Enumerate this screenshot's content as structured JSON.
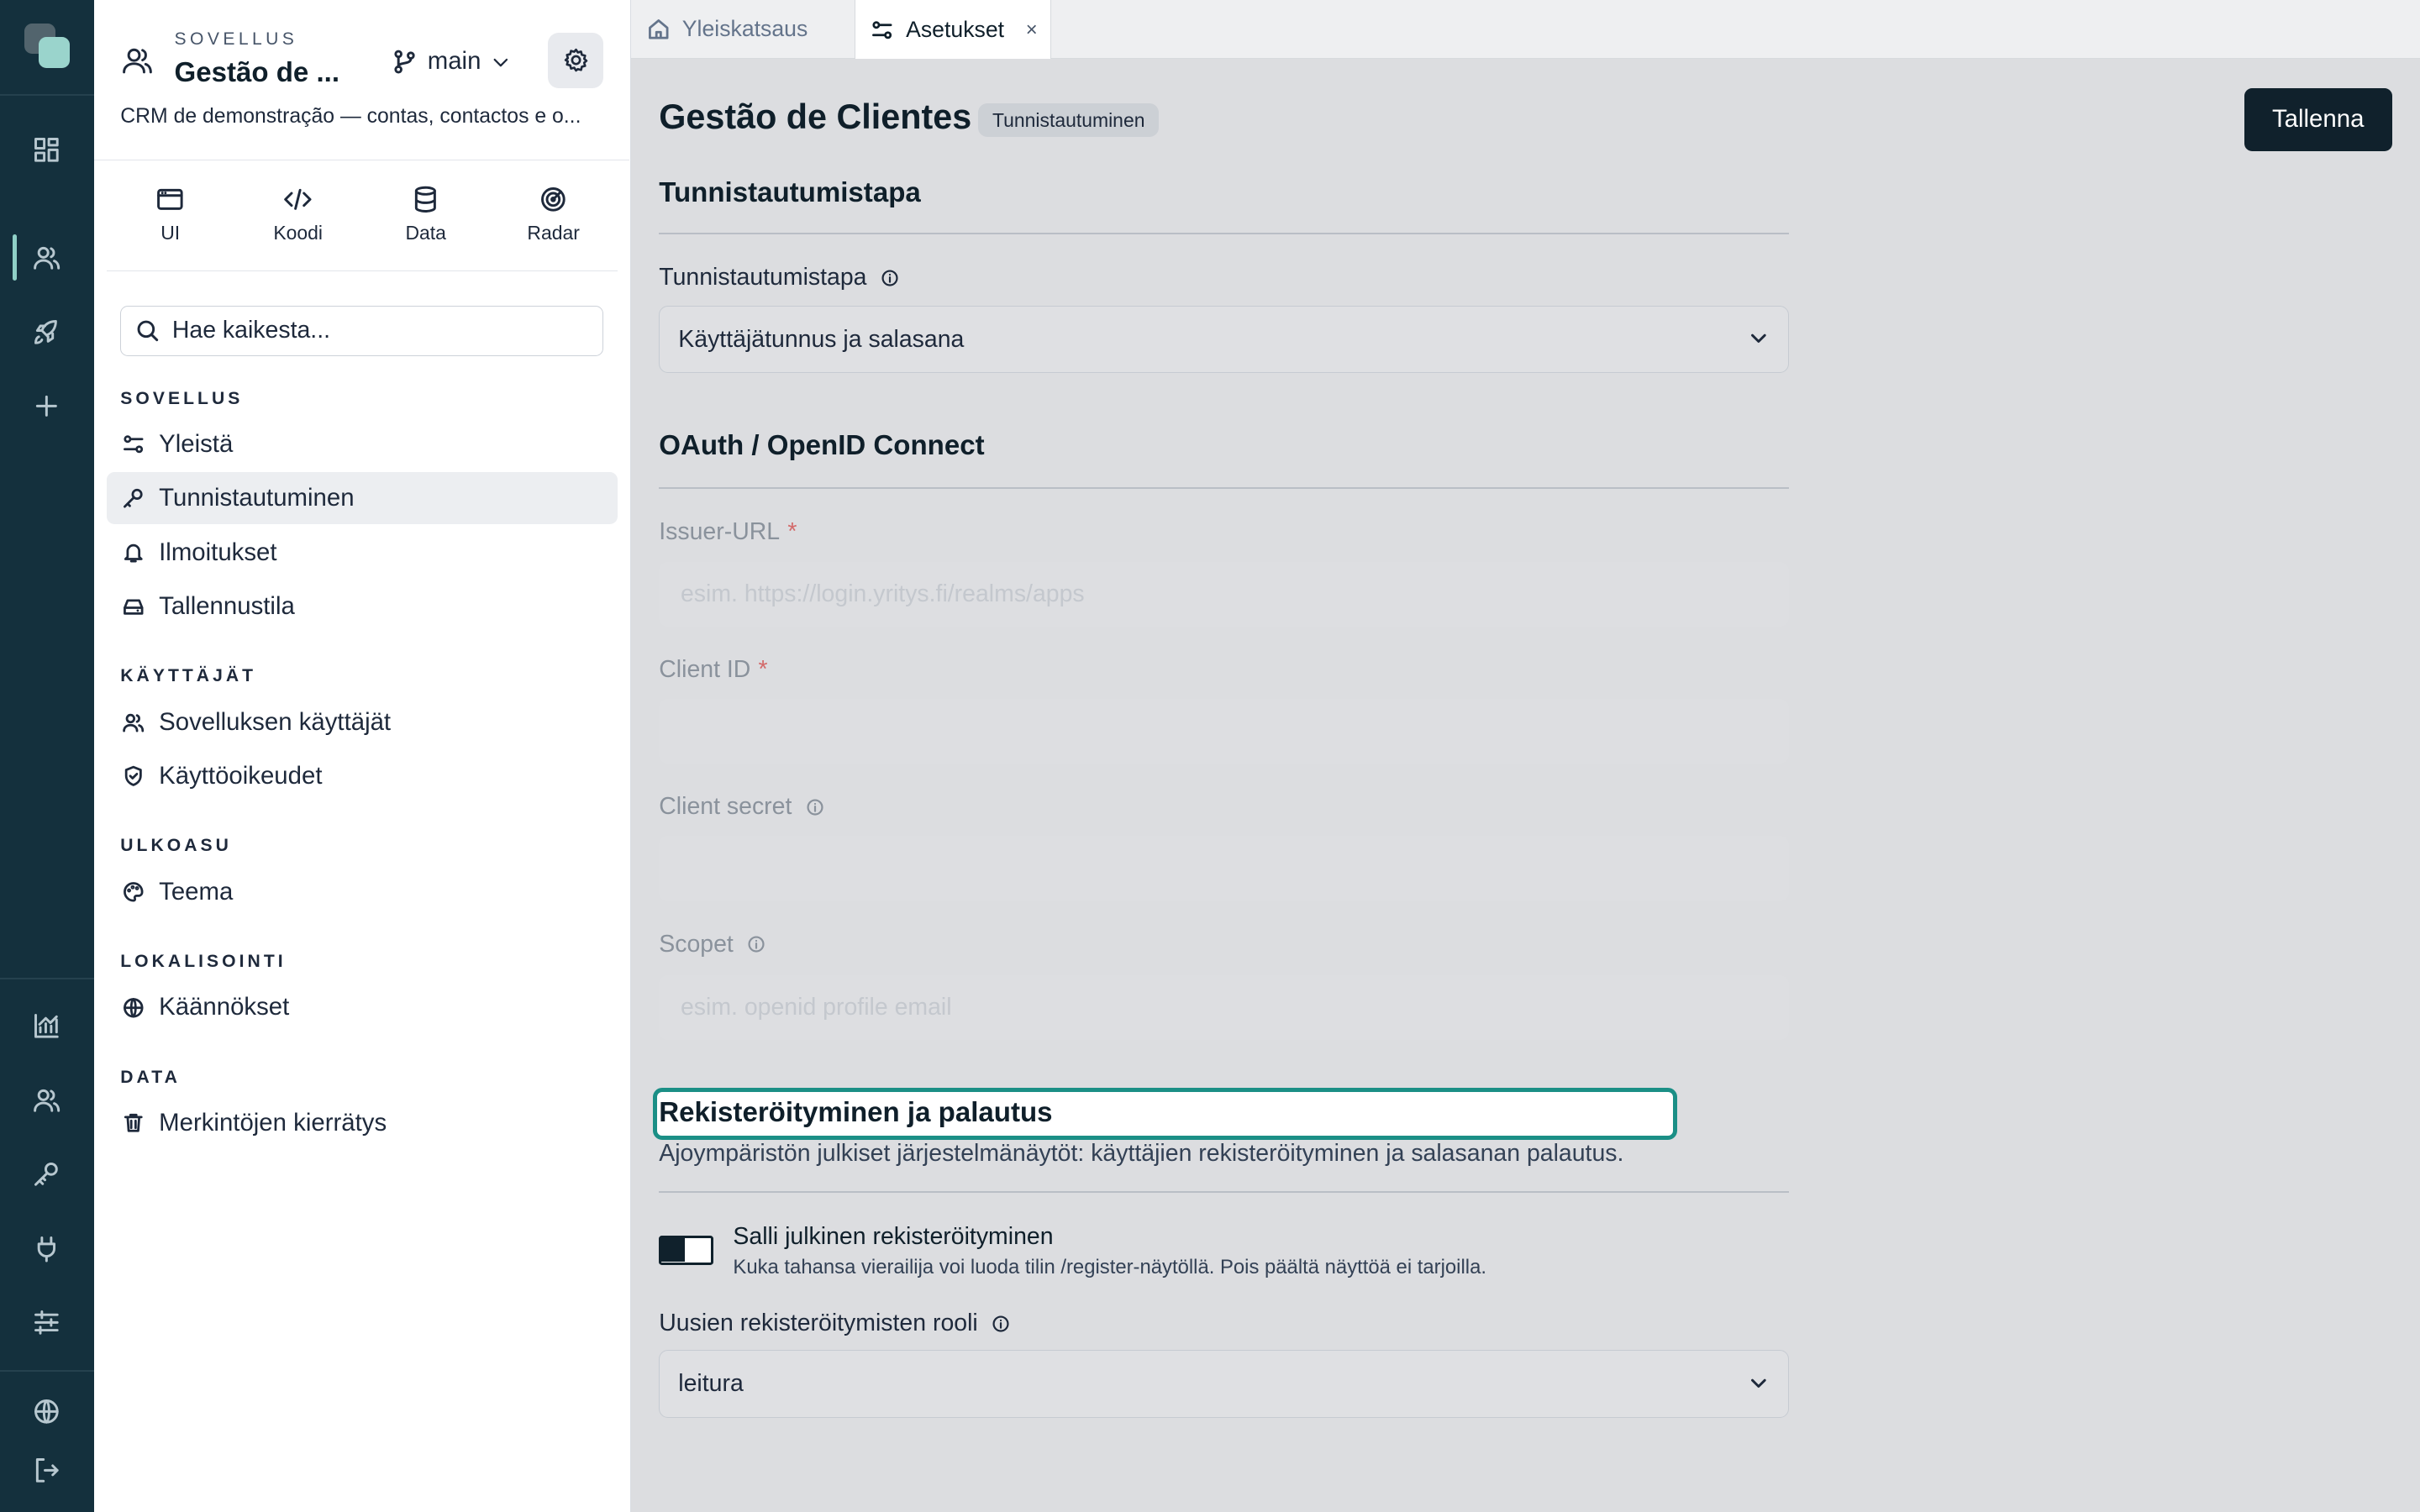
{
  "rail": {
    "icons": [
      "app-logo",
      "dashboard-icon",
      "users-icon",
      "rocket-icon",
      "plus-icon",
      "analytics-icon",
      "team-icon",
      "key-icon",
      "plug-icon",
      "sliders-icon",
      "globe-icon",
      "logout-icon"
    ]
  },
  "app": {
    "kicker": "SOVELLUS",
    "name": "Gestão de ...",
    "branch": "main",
    "description": "CRM de demonstração — contas, contactos e o..."
  },
  "modes": [
    {
      "label": "UI",
      "icon": "browser-window-icon"
    },
    {
      "label": "Koodi",
      "icon": "code-icon"
    },
    {
      "label": "Data",
      "icon": "database-icon"
    },
    {
      "label": "Radar",
      "icon": "radar-icon"
    }
  ],
  "search": {
    "placeholder": "Hae kaikesta..."
  },
  "nav": {
    "sections": [
      {
        "title": "SOVELLUS",
        "items": [
          "Yleistä",
          "Tunnistautuminen",
          "Ilmoitukset",
          "Tallennustila"
        ]
      },
      {
        "title": "KÄYTTÄJÄT",
        "items": [
          "Sovelluksen käyttäjät",
          "Käyttöoikeudet"
        ]
      },
      {
        "title": "ULKOASU",
        "items": [
          "Teema"
        ]
      },
      {
        "title": "LOKALISOINTI",
        "items": [
          "Käännökset"
        ]
      },
      {
        "title": "DATA",
        "items": [
          "Merkintöjen kierrätys"
        ]
      }
    ],
    "active": "Tunnistautuminen"
  },
  "tabs": [
    {
      "label": "Yleiskatsaus",
      "icon": "home-icon",
      "active": false
    },
    {
      "label": "Asetukset",
      "icon": "settings-sliders-icon",
      "active": true,
      "close": "×"
    }
  ],
  "page": {
    "title": "Gestão de Clientes",
    "chip": "Tunnistautuminen",
    "save_label": "Tallenna"
  },
  "auth": {
    "section_title": "Tunnistautumistapa",
    "field_label": "Tunnistautumistapa",
    "selected": "Käyttäjätunnus ja salasana"
  },
  "oauth": {
    "section_title": "OAuth / OpenID Connect",
    "issuer_label": "Issuer-URL",
    "issuer_placeholder": "esim. https://login.yritys.fi/realms/apps",
    "client_id_label": "Client ID",
    "client_secret_label": "Client secret",
    "scopes_label": "Scopet",
    "scopes_placeholder": "esim. openid profile email",
    "required_mark": "*"
  },
  "registration": {
    "title": "Rekisteröityminen ja palautus",
    "description": "Ajoympäristön julkiset järjestelmänäytöt: käyttäjien rekisteröityminen ja salasanan palautus.",
    "toggle_label": "Salli julkinen rekisteröityminen",
    "toggle_help": "Kuka tahansa vierailija voi luoda tilin /register-näytöllä. Pois päältä näyttöä ei tarjoilla.",
    "toggle_on": false,
    "role_label": "Uusien rekisteröitymisten rooli",
    "role_selected": "leitura"
  },
  "colors": {
    "rail": "#14303d",
    "accent": "#1b8f86",
    "primary_button": "#10212c"
  }
}
